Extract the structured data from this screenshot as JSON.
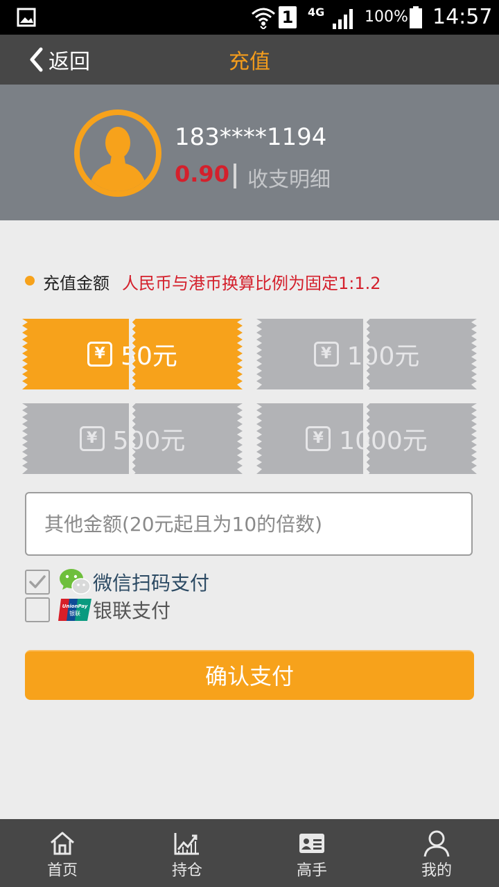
{
  "status_bar": {
    "sim_slot": "1",
    "network_type": "4G",
    "battery_percent": "100%",
    "time": "14:57"
  },
  "header": {
    "back_label": "返回",
    "title": "充值"
  },
  "profile": {
    "phone": "183****1194",
    "balance": "0.90",
    "detail_link": "收支明细"
  },
  "amount_section": {
    "label": "充值金额",
    "note": "人民币与港币换算比例为固定1:1.2"
  },
  "amount_options": [
    {
      "symbol": "¥",
      "label": "50元",
      "selected": true
    },
    {
      "symbol": "¥",
      "label": "100元",
      "selected": false
    },
    {
      "symbol": "¥",
      "label": "500元",
      "selected": false
    },
    {
      "symbol": "¥",
      "label": "1000元",
      "selected": false
    }
  ],
  "other_amount": {
    "placeholder": "其他金额(20元起且为10的倍数)",
    "value": ""
  },
  "payment_methods": [
    {
      "label": "微信扫码支付",
      "checked": true,
      "icon": "wechat-icon"
    },
    {
      "label": "银联支付",
      "checked": false,
      "icon": "unionpay-icon"
    }
  ],
  "confirm_label": "确认支付",
  "bottom_nav": [
    {
      "label": "首页",
      "icon": "home-icon"
    },
    {
      "label": "持仓",
      "icon": "chart-icon"
    },
    {
      "label": "高手",
      "icon": "id-card-icon"
    },
    {
      "label": "我的",
      "icon": "person-icon"
    }
  ],
  "colors": {
    "accent": "#f7a21b",
    "header_bg": "#474747",
    "profile_bg": "#7b8086",
    "warning_red": "#d4202c",
    "inactive_ticket": "#b2b3b6"
  }
}
